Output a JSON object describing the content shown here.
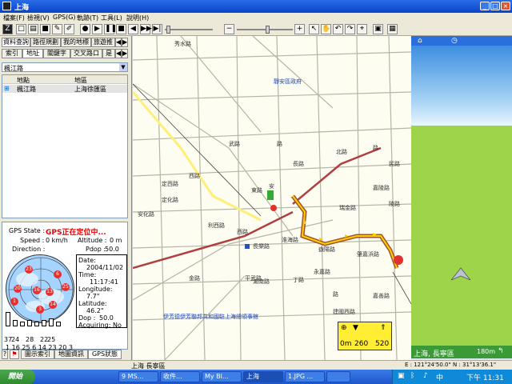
{
  "window": {
    "title": "上海",
    "controls": [
      "_",
      "□",
      "×"
    ]
  },
  "menu": [
    "檔案(F)",
    "檢視(V)",
    "GPS(G)",
    "軌跡(T)",
    "工具(L)",
    "說明(H)"
  ],
  "left": {
    "tabs_row1": [
      "資料查詢",
      "路徑規劃",
      "我的地標",
      "旅遊推"
    ],
    "tabs_row2": [
      "索引",
      "地址",
      "關鍵字",
      "交叉路口",
      "是"
    ],
    "dropdown_value": "楓江路",
    "list_headers": [
      "地點",
      "地區"
    ],
    "list_rows": [
      {
        "place": "楓江路",
        "region": "上海徐匯區"
      }
    ],
    "gps": {
      "state_label": "GPS State :",
      "state_value": "GPS正在定位中...",
      "speed_label": "Speed :",
      "speed_value": "0 km/h",
      "altitude_label": "Altitude :",
      "altitude_value": "0 m",
      "direction_label": "Direction :",
      "pdop_label": "Pdop :",
      "pdop_value": "50.0",
      "date_label": "Date:",
      "date_value": "2004/11/02",
      "time_label": "Time:",
      "time_value": "11:17:41",
      "longitude_label": "Longitude:",
      "longitude_value": "7.7\"",
      "latitude_label": "Latitude:",
      "latitude_value": "46.2\"",
      "dop_label": "Dop :",
      "dop_value": "50.0",
      "acquiring_label": "Acquiring: No",
      "satellites_in_view": [
        "23",
        "6",
        "20",
        "16",
        "3",
        "13",
        "14",
        "1",
        "25"
      ],
      "signal_top": [
        "37",
        "24",
        "",
        "28",
        "",
        "22",
        "25"
      ],
      "signal_bottom": [
        "1",
        "16",
        "25",
        "6",
        "14",
        "23",
        "20",
        "3"
      ],
      "signal_levels": [
        0.35,
        0.1,
        0.05,
        0.1,
        0.05,
        0.1,
        0.15,
        0.05
      ]
    },
    "bottom_tabs": [
      "圖示索引",
      "地圖資訊",
      "GPS狀態"
    ]
  },
  "map": {
    "streets": [
      "秀水路",
      "靜安區政府",
      "武路",
      "路",
      "西路",
      "定西路",
      "定化路",
      "安化路",
      "利西路",
      "西路",
      "金路",
      "平武路",
      "湖南路",
      "丁路",
      "東路",
      "安",
      "長樂路",
      "淮海路",
      "永嘉路",
      "路",
      "建國西路",
      "嘉善路",
      "嶽陽路",
      "肇嘉浜路",
      "民路",
      "瑞金路",
      "長路",
      "北路",
      "嘉陵路",
      "陵路",
      "路",
      "伊芳德伊芳聯邦共和國駐上海總領事館"
    ],
    "scale_label": "260",
    "scale_label2": "520",
    "scale_unit": "0m"
  },
  "nav": {
    "status": "上海, 長寧區",
    "distance": "180m"
  },
  "statusbar": {
    "location": "上海 長寧區",
    "coords": "E : 121°24'50.0\"  N : 31°13'36.1\""
  },
  "taskbar": {
    "start": "開始",
    "tasks": [
      "9 MS...",
      "收件...",
      "My Bl...",
      "上海",
      "1.JPG ...",
      ""
    ],
    "clock": "下午 11:31"
  },
  "colors": {
    "title_bar": "#0a44c8",
    "route": "#a0522d",
    "route_highlight": "#ffd000",
    "gps_warning": "#e00000",
    "map_bg": "#fdfdf2",
    "ground": "#9dd44a"
  }
}
